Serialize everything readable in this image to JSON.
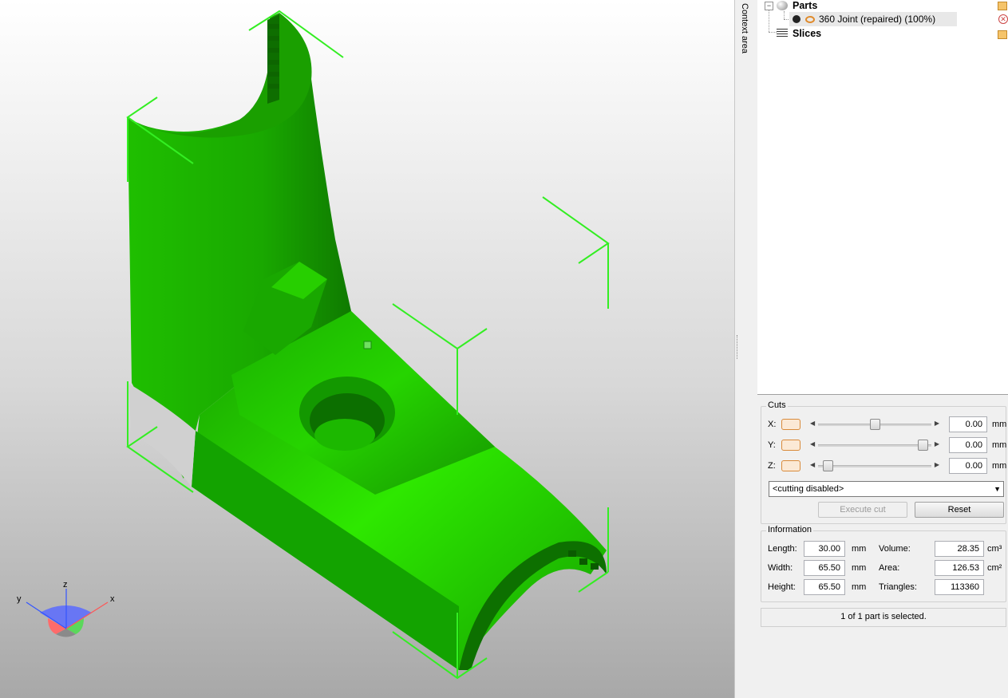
{
  "context_area": {
    "label": "Context area"
  },
  "tree": {
    "parts_label": "Parts",
    "part_item_label": "360 Joint (repaired) (100%)",
    "slices_label": "Slices"
  },
  "cuts": {
    "title": "Cuts",
    "axes": [
      {
        "label": "X:",
        "value": "0.00",
        "unit": "mm",
        "slider_fraction": 0.5
      },
      {
        "label": "Y:",
        "value": "0.00",
        "unit": "mm",
        "slider_fraction": 0.97
      },
      {
        "label": "Z:",
        "value": "0.00",
        "unit": "mm",
        "slider_fraction": 0.05
      }
    ],
    "mode_select": "<cutting disabled>",
    "execute_label": "Execute cut",
    "reset_label": "Reset"
  },
  "information": {
    "title": "Information",
    "length_label": "Length:",
    "length_value": "30.00",
    "length_unit": "mm",
    "width_label": "Width:",
    "width_value": "65.50",
    "width_unit": "mm",
    "height_label": "Height:",
    "height_value": "65.50",
    "height_unit": "mm",
    "volume_label": "Volume:",
    "volume_value": "28.35",
    "volume_unit": "cm³",
    "area_label": "Area:",
    "area_value": "126.53",
    "area_unit": "cm²",
    "triangles_label": "Triangles:",
    "triangles_value": "113360"
  },
  "status": {
    "text": "1 of 1 part is selected."
  },
  "axis_gizmo": {
    "x": "x",
    "y": "y",
    "z": "z"
  },
  "colors": {
    "model": "#22cc00",
    "bbox": "#33ee22",
    "accent_toggle": "#d98a3a"
  }
}
